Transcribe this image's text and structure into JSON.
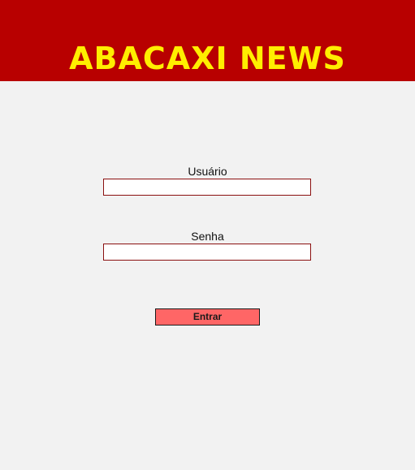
{
  "header": {
    "title": "ABACAXI NEWS"
  },
  "login_form": {
    "username_label": "Usuário",
    "username_value": "",
    "password_label": "Senha",
    "password_value": "",
    "submit_label": "Entrar"
  },
  "colors": {
    "header_background": "#b80000",
    "brand_text": "#ffee00",
    "page_background": "#f2f2f2",
    "input_border": "#8a1010",
    "button_background": "#ff6666"
  }
}
